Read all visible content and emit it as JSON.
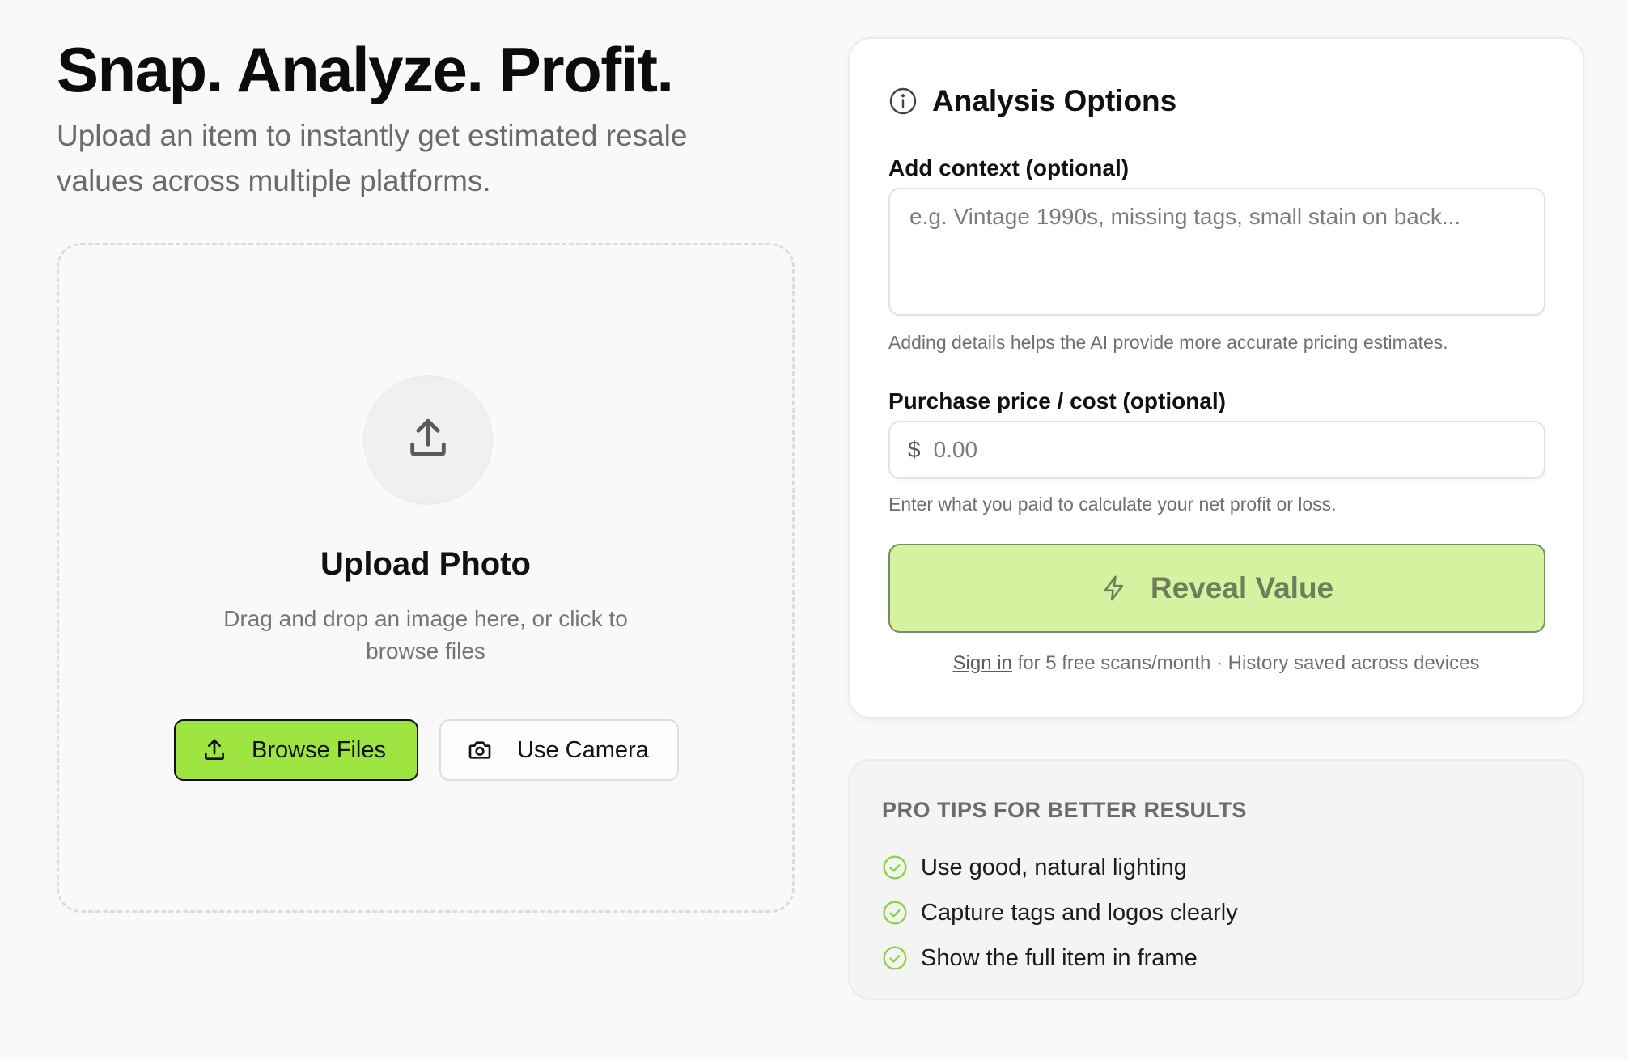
{
  "hero": {
    "title": "Snap. Analyze. Profit.",
    "subtitle": "Upload an item to instantly get estimated resale values across multiple platforms."
  },
  "upload": {
    "icon": "upload-icon",
    "title": "Upload Photo",
    "description": "Drag and drop an image here, or click to browse files",
    "browse_label": "Browse Files",
    "camera_label": "Use Camera"
  },
  "options": {
    "title": "Analysis Options",
    "context_label": "Add context (optional)",
    "context_placeholder": "e.g. Vintage 1990s, missing tags, small stain on back...",
    "context_value": "",
    "context_helper": "Adding details helps the AI provide more accurate pricing estimates.",
    "price_label": "Purchase price / cost (optional)",
    "currency_symbol": "$",
    "price_placeholder": "0.00",
    "price_value": "",
    "price_helper": "Enter what you paid to calculate your net profit or loss.",
    "reveal_label": "Reveal Value",
    "signin_link": "Sign in",
    "signin_text": " for 5 free scans/month · History saved across devices"
  },
  "tips": {
    "title": "PRO TIPS FOR BETTER RESULTS",
    "items": [
      "Use good, natural lighting",
      "Capture tags and logos clearly",
      "Show the full item in frame"
    ]
  },
  "colors": {
    "accent": "#9ee542",
    "accent_disabled": "#d3f3a0",
    "check": "#8ad43f",
    "background": "#f9f9f9"
  }
}
